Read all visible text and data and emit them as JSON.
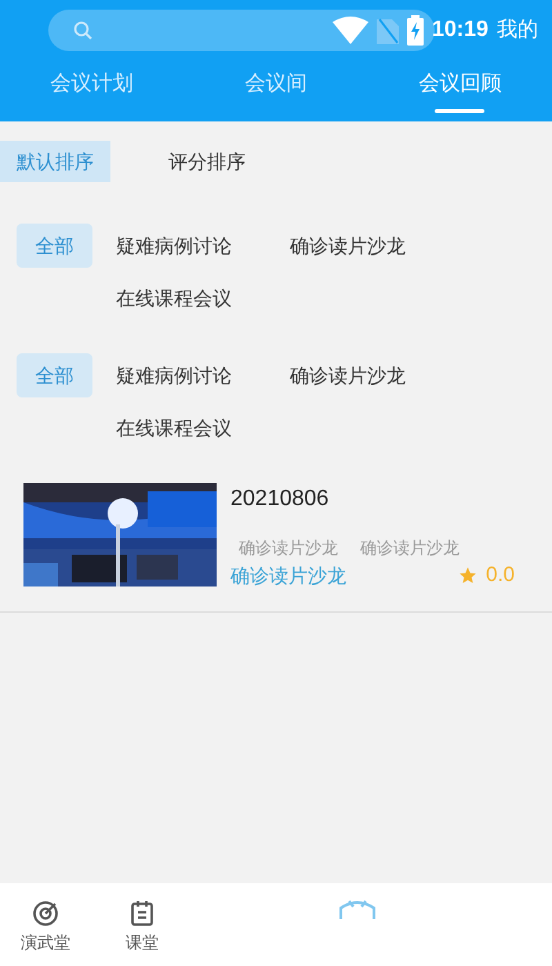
{
  "status_bar": {
    "time": "10:19"
  },
  "header": {
    "account_label": "我的"
  },
  "tabs": [
    {
      "label": "会议计划",
      "selected": false
    },
    {
      "label": "会议间",
      "selected": false
    },
    {
      "label": "会议回顾",
      "selected": true
    }
  ],
  "sort_options": [
    {
      "label": "默认排序",
      "selected": true
    },
    {
      "label": "评分排序",
      "selected": false
    }
  ],
  "filter_groups": [
    {
      "options": [
        {
          "label": "全部",
          "selected": true
        },
        {
          "label": "疑难病例讨论",
          "selected": false
        },
        {
          "label": "确诊读片沙龙",
          "selected": false
        },
        {
          "label": "在线课程会议",
          "selected": false
        }
      ]
    },
    {
      "options": [
        {
          "label": "全部",
          "selected": true
        },
        {
          "label": "疑难病例讨论",
          "selected": false
        },
        {
          "label": "确诊读片沙龙",
          "selected": false
        },
        {
          "label": "在线课程会议",
          "selected": false
        }
      ]
    }
  ],
  "meetings": [
    {
      "title": "20210806",
      "tags": [
        "确诊读片沙龙",
        "确诊读片沙龙"
      ],
      "category": "确诊读片沙龙",
      "rating": "0.0"
    }
  ],
  "bottom_nav": [
    {
      "label": "演武堂",
      "kind": "target",
      "selected": false
    },
    {
      "label": "课堂",
      "kind": "notebook",
      "selected": false
    },
    {
      "kind": "blurred",
      "selected": true
    }
  ]
}
